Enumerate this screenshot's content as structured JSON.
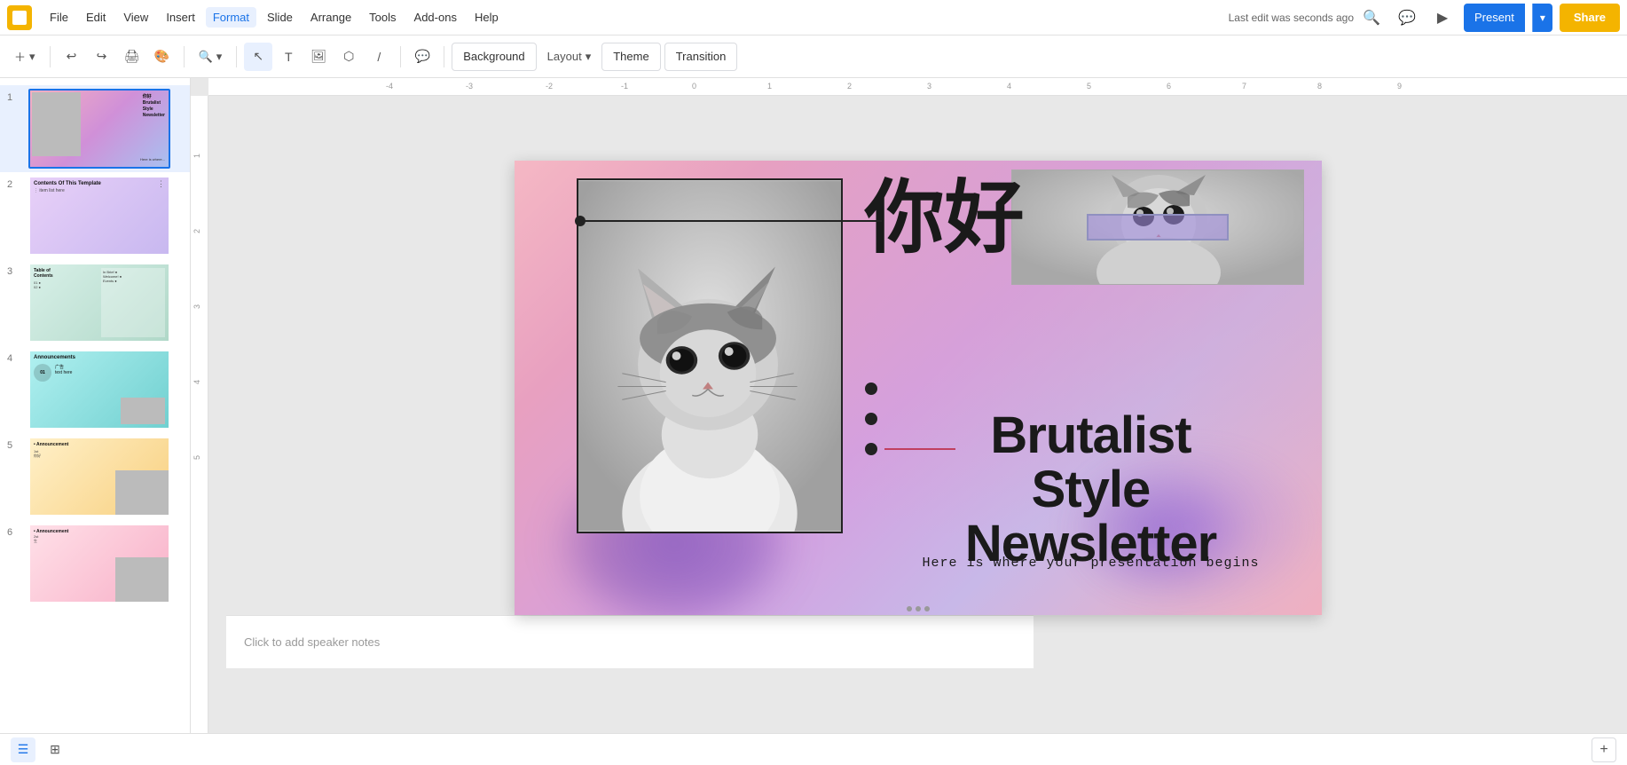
{
  "app": {
    "icon_color": "#f4b400",
    "last_edit": "Last edit was seconds ago"
  },
  "menu": {
    "items": [
      "File",
      "Edit",
      "View",
      "Insert",
      "Format",
      "Slide",
      "Arrange",
      "Tools",
      "Add-ons",
      "Help"
    ]
  },
  "toolbar": {
    "background_btn": "Background",
    "layout_btn": "Layout",
    "theme_btn": "Theme",
    "transition_btn": "Transition"
  },
  "header_right": {
    "present_label": "Present",
    "share_label": "Share"
  },
  "slides": [
    {
      "num": "1",
      "active": true,
      "chinese": "你好",
      "title_line1": "Brutalist",
      "title_line2": "Style",
      "title_line3": "Newsletter",
      "subtitle": "Here is where your presentation begins"
    },
    {
      "num": "2",
      "title": "Contents Of This Template"
    },
    {
      "num": "3",
      "title": "Table of Contents"
    },
    {
      "num": "4",
      "title": "Announcements"
    },
    {
      "num": "5",
      "title": "Announcement 1st"
    },
    {
      "num": "6",
      "title": "Announcement 2nd"
    }
  ],
  "current_slide": {
    "chinese_big": "你好",
    "title_line1": "Brutalist",
    "title_line2": "Style",
    "title_line3": "Newsletter",
    "subtitle": "Here is where your presentation begins"
  },
  "speaker_notes": {
    "placeholder": "Click to add speaker notes"
  },
  "bottom_view": {
    "grid_label": "Grid view",
    "filmstrip_label": "Filmstrip"
  }
}
